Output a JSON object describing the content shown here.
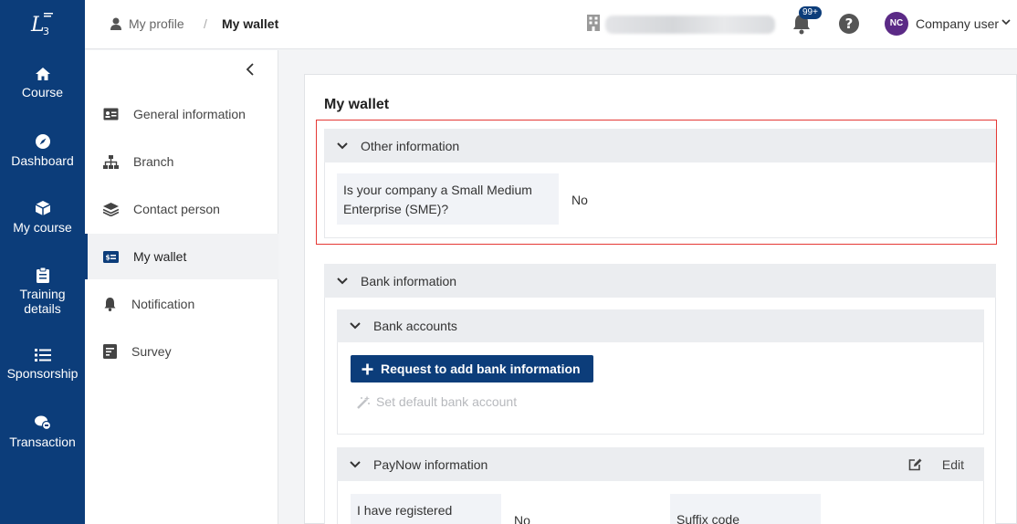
{
  "rail": {
    "items": [
      {
        "label": "Course",
        "icon": "home-icon"
      },
      {
        "label": "Dashboard",
        "icon": "compass-icon"
      },
      {
        "label": "My course",
        "icon": "box-icon"
      },
      {
        "label": "Training details",
        "icon": "clipboard-icon"
      },
      {
        "label": "Sponsorship",
        "icon": "list-icon"
      },
      {
        "label": "Transaction",
        "icon": "chat-coins-icon"
      }
    ]
  },
  "breadcrumb": {
    "home": "My profile",
    "separator": "/",
    "current": "My wallet"
  },
  "header": {
    "notifications_count": "99+",
    "avatar_initials": "NC",
    "user_name": "Company user"
  },
  "sidebar": {
    "items": [
      {
        "label": "General information"
      },
      {
        "label": "Branch"
      },
      {
        "label": "Contact person"
      },
      {
        "label": "My wallet"
      },
      {
        "label": "Notification"
      },
      {
        "label": "Survey"
      }
    ]
  },
  "main": {
    "title": "My wallet",
    "other_info": {
      "title": "Other information",
      "sme_label": "Is your company a Small Medium Enterprise (SME)?",
      "sme_value": "No"
    },
    "bank_info": {
      "title": "Bank information",
      "accounts": {
        "title": "Bank accounts",
        "add_button": "Request to add bank information",
        "default_button": "Set default bank account"
      },
      "paynow": {
        "title": "PayNow information",
        "edit_label": "Edit",
        "registered_label": "I have registered",
        "registered_value": "No",
        "suffix_label": "Suffix code"
      }
    }
  },
  "colors": {
    "brand": "#0c3d7a",
    "highlight": "#e53935",
    "avatar": "#5b2a86"
  }
}
